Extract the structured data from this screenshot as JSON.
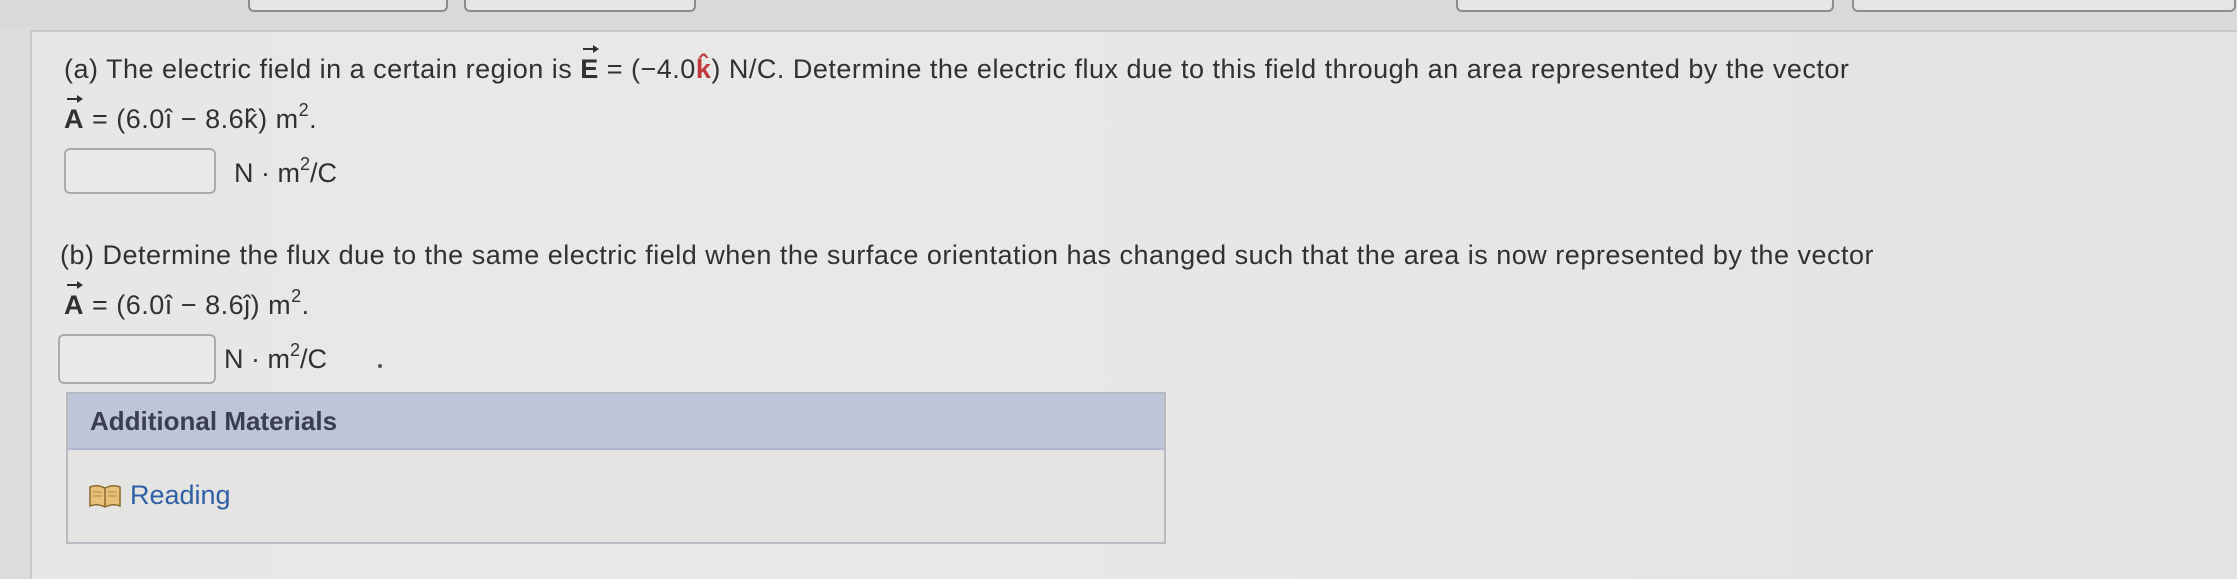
{
  "part_a": {
    "line1_prefix": "(a) The electric field in a certain region is ",
    "E_symbol": "E",
    "line1_mid": " = (−4.0",
    "k_hat": "k̂",
    "line1_suffix": ") N/C.  Determine the electric flux due to this field through an area represented by the vector",
    "A_symbol": "A",
    "line2": " = (6.0î − 8.6k̂) m",
    "line2_exp": "2",
    "line2_end": ".",
    "answer_value": "",
    "unit_prefix": "N · m",
    "unit_exp": "2",
    "unit_suffix": "/C"
  },
  "part_b": {
    "line1": "(b) Determine the flux due to the same electric field when the surface orientation has changed such that the area is now represented by the vector",
    "A_symbol": "A",
    "line2": " = (6.0î − 8.6ĵ) m",
    "line2_exp": "2",
    "line2_end": ".",
    "answer_value": "",
    "unit_prefix": "N · m",
    "unit_exp": "2",
    "unit_suffix": "/C"
  },
  "additional_materials": {
    "header": "Additional Materials",
    "reading_label": "Reading",
    "reading_icon": "book-icon"
  },
  "colors": {
    "unit_vector_k": "#c0393b",
    "link": "#2f5fa5",
    "materials_header_bg": "#bfc5d9"
  }
}
